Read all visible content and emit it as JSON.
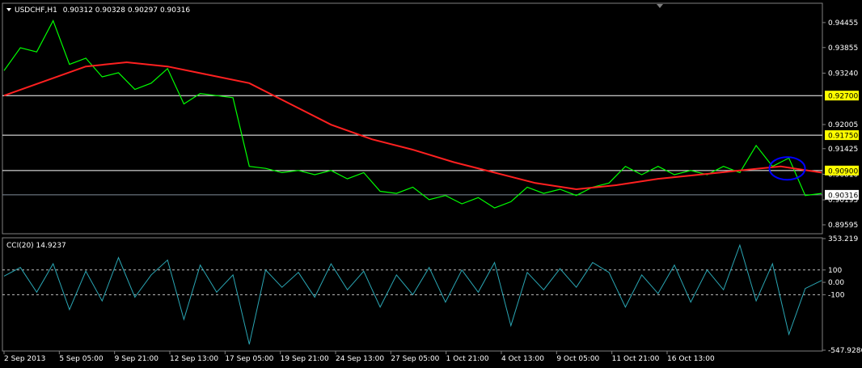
{
  "chart_data": [
    {
      "type": "line",
      "header": {
        "symbol_timeframe": "USDCHF,H1",
        "ohlc": "0.90312 0.90328 0.90297 0.90316"
      },
      "y_ticks": [
        "0.94455",
        "0.93855",
        "0.93240",
        "0.92005",
        "0.91425",
        "0.90810",
        "0.90195",
        "0.89595"
      ],
      "y_range": [
        0.894,
        0.949
      ],
      "x_labels": [
        "2 Sep 2013",
        "5 Sep 05:00",
        "9 Sep 21:00",
        "12 Sep 13:00",
        "17 Sep 05:00",
        "19 Sep 21:00",
        "24 Sep 13:00",
        "27 Sep 05:00",
        "1 Oct 21:00",
        "4 Oct 13:00",
        "9 Oct 05:00",
        "11 Oct 21:00",
        "16 Oct 13:00"
      ],
      "horizontal_levels": [
        {
          "label": "0.92700",
          "value": 0.927,
          "color": "#ffffff",
          "label_bg": "#ffff00"
        },
        {
          "label": "0.91750",
          "value": 0.9175,
          "color": "#ffffff",
          "label_bg": "#ffff00"
        },
        {
          "label": "0.90900",
          "value": 0.909,
          "color": "#ffffff",
          "label_bg": "#ffff00"
        },
        {
          "label": "0.90316",
          "value": 0.90316,
          "color": "#7f8c99",
          "label_bg": "#ffffff"
        }
      ],
      "series": [
        {
          "role": "price",
          "color": "#00ff00",
          "x": [
            0,
            2,
            4,
            6,
            8,
            10,
            12,
            14,
            16,
            18,
            20,
            22,
            24,
            26,
            28,
            30,
            32,
            34,
            36,
            38,
            40,
            42,
            44,
            46,
            48,
            50,
            52,
            54,
            56,
            58,
            60,
            62,
            64,
            66,
            68,
            70,
            72,
            74,
            76,
            78,
            80,
            82,
            84,
            86,
            88,
            90,
            92,
            94,
            96,
            98,
            100
          ],
          "values": [
            0.933,
            0.9385,
            0.9375,
            0.945,
            0.9345,
            0.936,
            0.9315,
            0.9325,
            0.9285,
            0.93,
            0.9335,
            0.925,
            0.9275,
            0.927,
            0.9265,
            0.91,
            0.9095,
            0.9085,
            0.909,
            0.908,
            0.909,
            0.907,
            0.9085,
            0.904,
            0.9035,
            0.905,
            0.902,
            0.903,
            0.901,
            0.9025,
            0.9,
            0.9015,
            0.905,
            0.9035,
            0.9045,
            0.903,
            0.905,
            0.906,
            0.91,
            0.908,
            0.91,
            0.908,
            0.909,
            0.908,
            0.91,
            0.9085,
            0.915,
            0.91,
            0.912,
            0.903,
            0.9035
          ]
        },
        {
          "role": "moving_average",
          "color": "#ff2020",
          "x": [
            0,
            5,
            10,
            15,
            20,
            25,
            30,
            35,
            40,
            45,
            50,
            55,
            60,
            65,
            70,
            75,
            80,
            85,
            90,
            95,
            100
          ],
          "values": [
            0.927,
            0.9305,
            0.934,
            0.935,
            0.934,
            0.932,
            0.93,
            0.925,
            0.92,
            0.9165,
            0.914,
            0.911,
            0.9085,
            0.906,
            0.9045,
            0.9055,
            0.907,
            0.908,
            0.909,
            0.91,
            0.9085
          ]
        }
      ],
      "annotation": {
        "shape": "ellipse",
        "color": "#0000ff",
        "x": 95.8,
        "y": 0.9095
      }
    },
    {
      "type": "line",
      "header": {
        "label": "CCI(20) 14.9237"
      },
      "y_ticks": [
        "353.219",
        "100",
        "0.00",
        "-100",
        "-547.9286"
      ],
      "y_range": [
        -547.9286,
        353.219
      ],
      "levels": [
        100,
        -100
      ],
      "series": [
        {
          "role": "cci",
          "color": "#2aa6b4",
          "x": [
            0,
            2,
            4,
            6,
            8,
            10,
            12,
            14,
            16,
            18,
            20,
            22,
            24,
            26,
            28,
            30,
            32,
            34,
            36,
            38,
            40,
            42,
            44,
            46,
            48,
            50,
            52,
            54,
            56,
            58,
            60,
            62,
            64,
            66,
            68,
            70,
            72,
            74,
            76,
            78,
            80,
            82,
            84,
            86,
            88,
            90,
            92,
            94,
            96,
            98,
            100
          ],
          "values": [
            50,
            120,
            -80,
            150,
            -220,
            90,
            -150,
            200,
            -120,
            60,
            180,
            -300,
            140,
            -80,
            60,
            -500,
            100,
            -40,
            80,
            -120,
            150,
            -60,
            90,
            -200,
            60,
            -100,
            120,
            -160,
            100,
            -80,
            160,
            -350,
            80,
            -60,
            110,
            -40,
            160,
            80,
            -200,
            60,
            -90,
            140,
            -160,
            100,
            -60,
            300,
            -150,
            150,
            -420,
            -50,
            15
          ]
        }
      ]
    }
  ]
}
